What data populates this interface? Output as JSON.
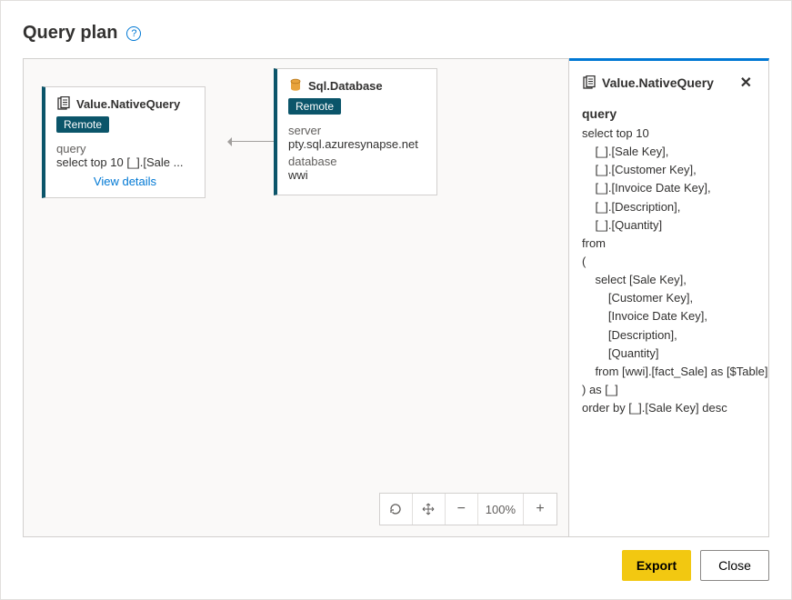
{
  "header": {
    "title": "Query plan"
  },
  "canvas": {
    "node_query": {
      "title": "Value.NativeQuery",
      "badge": "Remote",
      "label": "query",
      "preview": "select top 10 [_].[Sale ...",
      "view_details": "View details"
    },
    "node_db": {
      "title": "Sql.Database",
      "badge": "Remote",
      "server_label": "server",
      "server_value": "pty.sql.azuresynapse.net",
      "database_label": "database",
      "database_value": "wwi"
    },
    "zoom": {
      "percent": "100%"
    }
  },
  "details": {
    "title": "Value.NativeQuery",
    "section_label": "query",
    "sql": "select top 10\n    [_].[Sale Key],\n    [_].[Customer Key],\n    [_].[Invoice Date Key],\n    [_].[Description],\n    [_].[Quantity]\nfrom\n(\n    select [Sale Key],\n        [Customer Key],\n        [Invoice Date Key],\n        [Description],\n        [Quantity]\n    from [wwi].[fact_Sale] as [$Table]\n) as [_]\norder by [_].[Sale Key] desc"
  },
  "footer": {
    "export": "Export",
    "close": "Close"
  }
}
